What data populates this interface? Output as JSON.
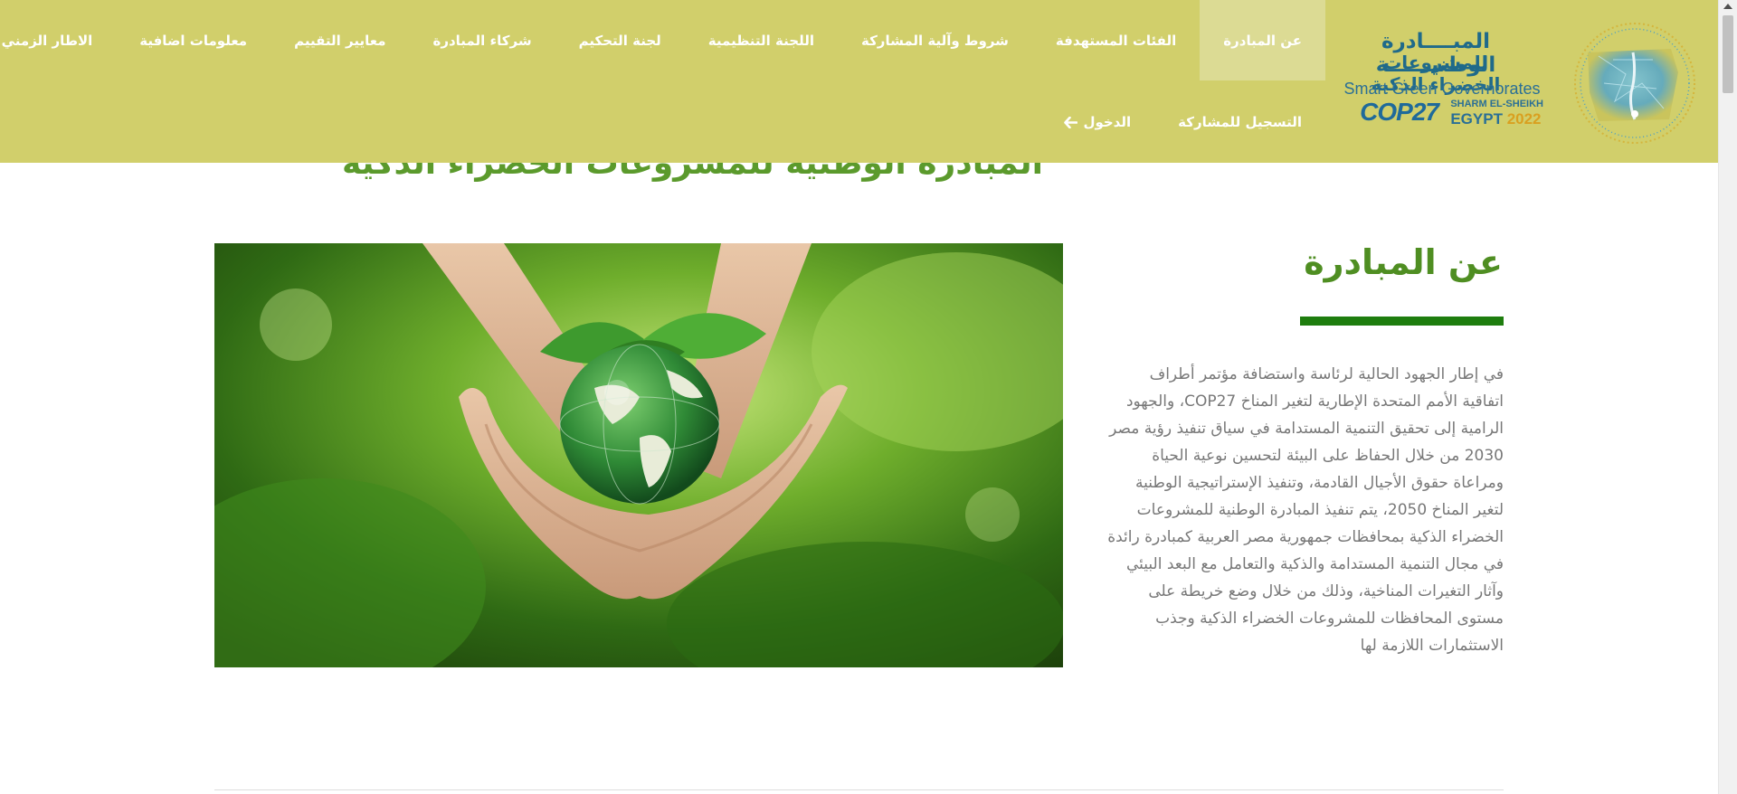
{
  "brand": {
    "arabic_line1": "المبــــادرة الوطنيــــــة",
    "arabic_line2": "للمشروعات الخضراء الذكية",
    "english_line": "Smart Green Governorates",
    "cop_prefix": "COP",
    "cop_number": "27",
    "location": "SHARM EL-SHEIKH",
    "country": "EGYPT",
    "year": "2022"
  },
  "nav": {
    "items": [
      {
        "label": "عن المبادرة",
        "active": true
      },
      {
        "label": "الفئات المستهدفة"
      },
      {
        "label": "شروط وآلية المشاركة"
      },
      {
        "label": "اللجنة التنظيمية"
      },
      {
        "label": "لجنة التحكيم"
      },
      {
        "label": "شركاء المبادرة"
      },
      {
        "label": "معايير التقييم"
      },
      {
        "label": "معلومات اضافية"
      },
      {
        "label": "الاطار الزمني للمبادرة"
      }
    ],
    "register": "التسجيل للمشاركة",
    "login": "الدخول",
    "login_icon": "arrow-left-icon"
  },
  "hero": {
    "title": "المبادرة الوطنية للمشروعات الخضراء الذكية"
  },
  "about": {
    "heading": "عن المبادرة",
    "body": "في إطار الجهود الحالية لرئاسة واستضافة مؤتمر أطراف اتفاقية الأمم المتحدة الإطارية لتغير المناخ COP27، والجهود الرامية إلى تحقيق التنمية المستدامة في سياق تنفيذ رؤية مصر 2030 من خلال الحفاظ على البيئة لتحسين نوعية الحياة ومراعاة حقوق الأجيال القادمة، وتنفيذ الإستراتيجية الوطنية لتغير المناخ 2050، يتم تنفيذ المبادرة الوطنية للمشروعات الخضراء الذكية بمحافظات جمهورية مصر العربية كمبادرة رائدة في مجال التنمية المستدامة والذكية والتعامل مع البعد البيئي وآثار التغيرات المناخية، وذلك من خلال وضع خريطة على مستوى المحافظات للمشروعات الخضراء الذكية وجذب الاستثمارات اللازمة لها",
    "image_subject": "hands-holding-green-globe"
  },
  "colors": {
    "navbar_bg": "#d1cf6b",
    "nav_active_bg": "#dcdb94",
    "heading_green": "#4f8e22",
    "underline_green": "#1e7d0e",
    "body_text": "#787878"
  }
}
